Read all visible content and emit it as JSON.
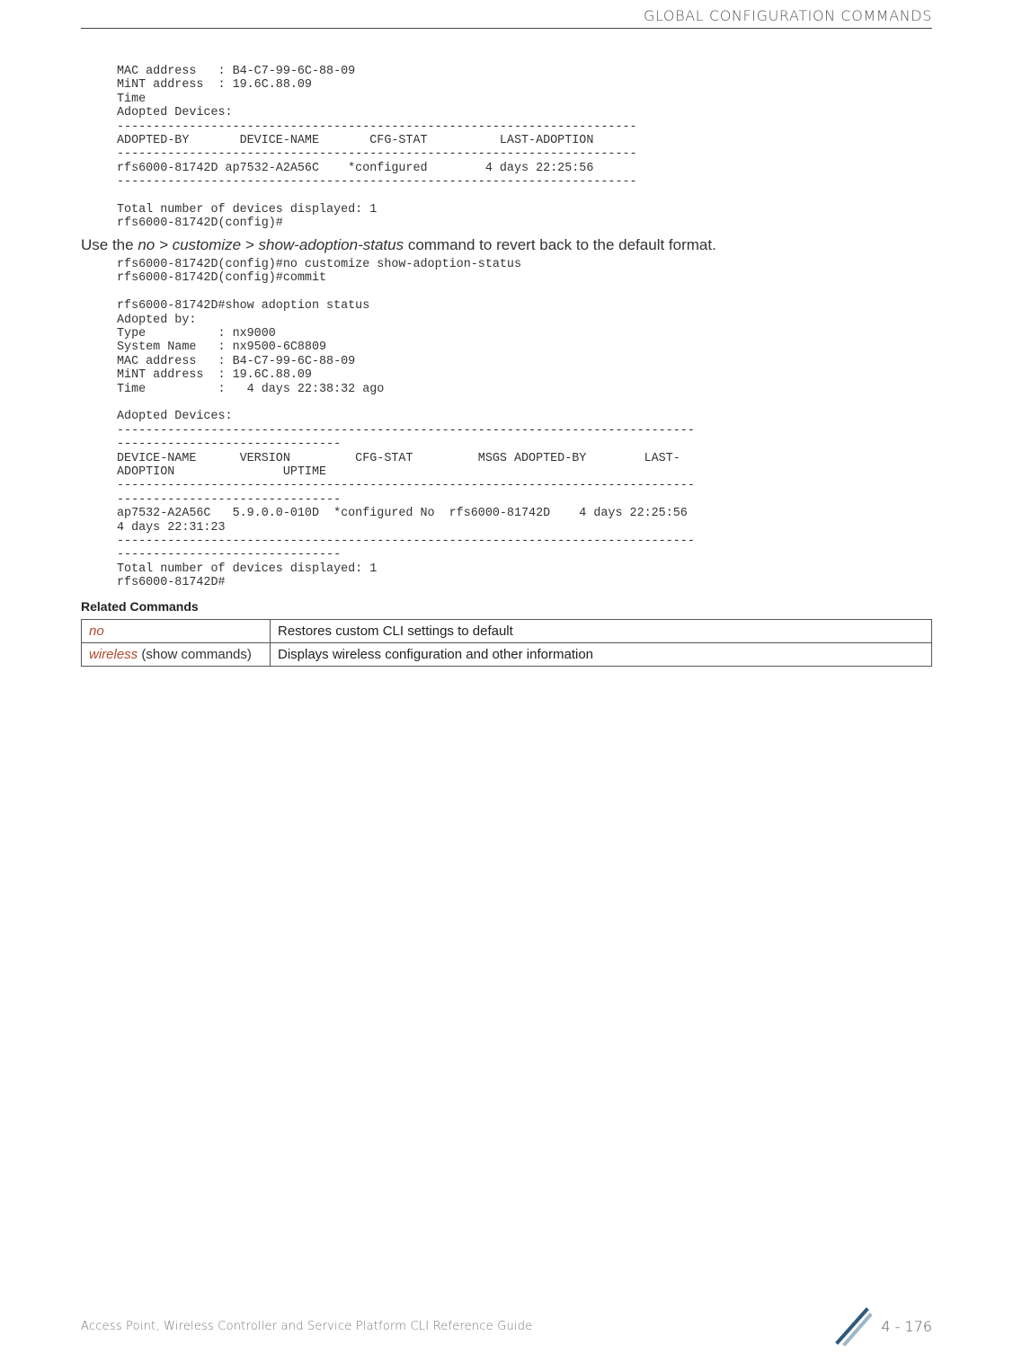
{
  "header": {
    "title": "GLOBAL CONFIGURATION COMMANDS"
  },
  "terminal1": "MAC address   : B4-C7-99-6C-88-09\nMiNT address  : 19.6C.88.09\nTime\nAdopted Devices:\n------------------------------------------------------------------------\nADOPTED-BY       DEVICE-NAME       CFG-STAT          LAST-ADOPTION\n------------------------------------------------------------------------\nrfs6000-81742D ap7532-A2A56C    *configured        4 days 22:25:56\n------------------------------------------------------------------------\n\nTotal number of devices displayed: 1\nrfs6000-81742D(config)#",
  "narrative": {
    "prefix": "Use the ",
    "command": "no > customize > show-adoption-status",
    "suffix": " command to revert back to the default format."
  },
  "terminal2": "rfs6000-81742D(config)#no customize show-adoption-status\nrfs6000-81742D(config)#commit\n\nrfs6000-81742D#show adoption status\nAdopted by:\nType          : nx9000\nSystem Name   : nx9500-6C8809\nMAC address   : B4-C7-99-6C-88-09\nMiNT address  : 19.6C.88.09\nTime          :   4 days 22:38:32 ago\n\nAdopted Devices:\n--------------------------------------------------------------------------------\n-------------------------------\nDEVICE-NAME      VERSION         CFG-STAT         MSGS ADOPTED-BY        LAST-\nADOPTION               UPTIME\n--------------------------------------------------------------------------------\n-------------------------------\nap7532-A2A56C   5.9.0.0-010D  *configured No  rfs6000-81742D    4 days 22:25:56   \n4 days 22:31:23\n--------------------------------------------------------------------------------\n-------------------------------\nTotal number of devices displayed: 1\nrfs6000-81742D#",
  "related_label": "Related Commands",
  "related": [
    {
      "key_italic": "no",
      "key_plain": "",
      "desc": "Restores custom CLI settings to default"
    },
    {
      "key_italic": "wireless",
      "key_plain": " (show commands)",
      "desc": "Displays wireless configuration and other information"
    }
  ],
  "footer": {
    "text": "Access Point, Wireless Controller and Service Platform CLI Reference Guide",
    "page": "4 - 176"
  }
}
